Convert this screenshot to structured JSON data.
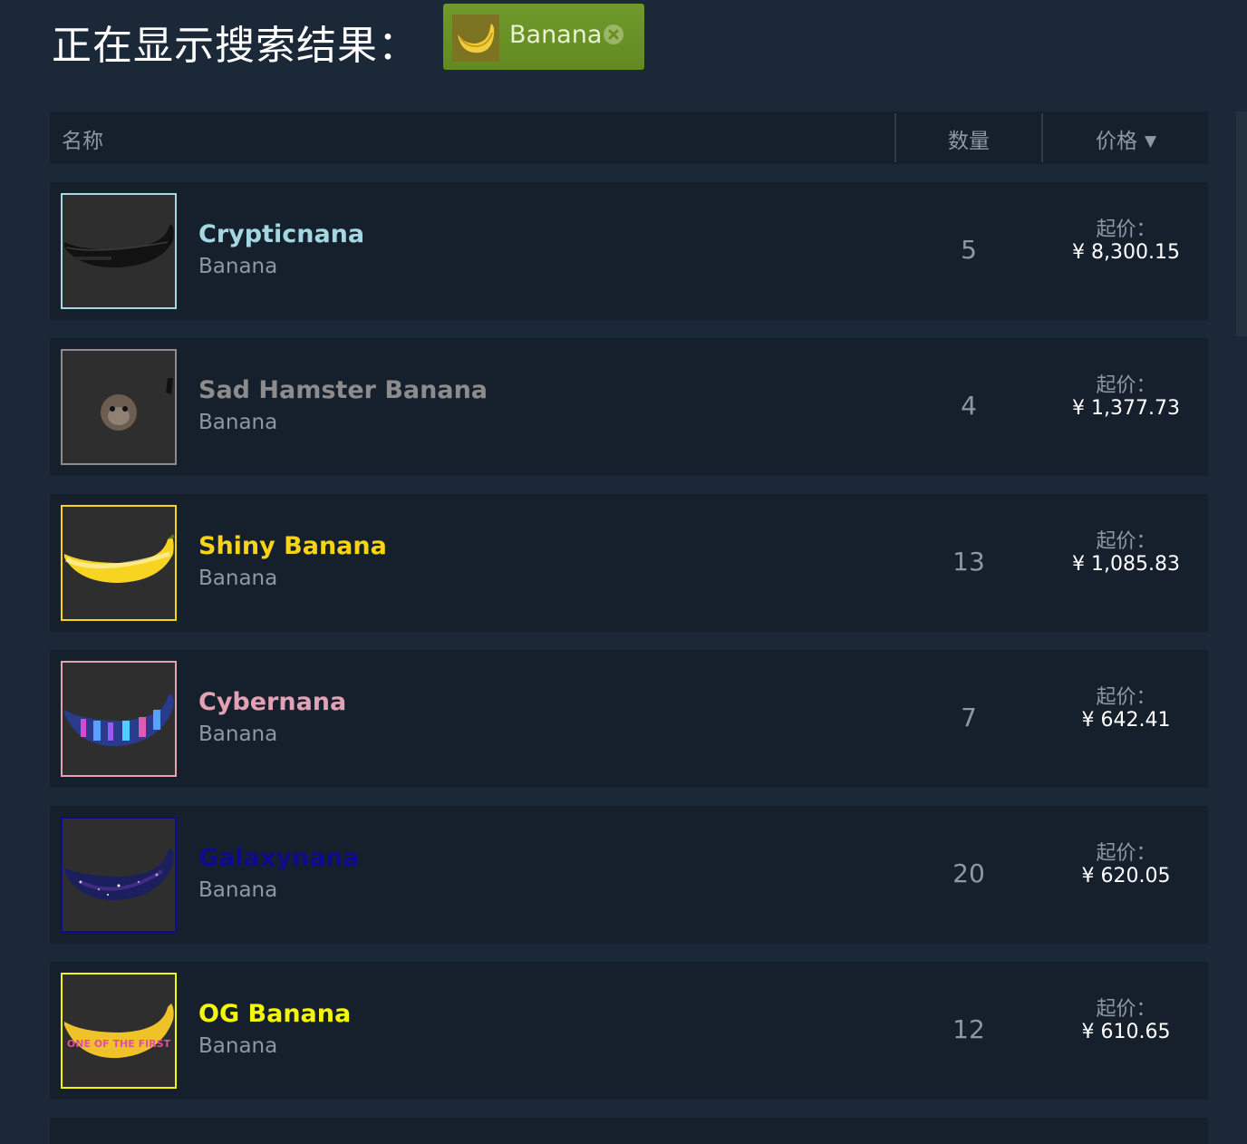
{
  "search": {
    "title": "正在显示搜索结果：",
    "filter_tag": {
      "label": "Banana",
      "remove_icon": "close-circle-icon"
    }
  },
  "table": {
    "columns": {
      "name": "名称",
      "quantity": "数量",
      "price": "价格",
      "sort_indicator": "▼"
    }
  },
  "listings": [
    {
      "name": "Crypticnana",
      "game": "Banana",
      "quantity": "5",
      "price_label": "起价：",
      "price": "¥ 8,300.15",
      "name_color": "#a3d8e3",
      "border_color": "#a3d8e3",
      "thumb": "crypticnana-banana"
    },
    {
      "name": "Sad Hamster Banana",
      "game": "Banana",
      "quantity": "4",
      "price_label": "起价：",
      "price": "¥ 1,377.73",
      "name_color": "#8c8c8c",
      "border_color": "#8c8c8c",
      "thumb": "sad-hamster-banana"
    },
    {
      "name": "Shiny Banana",
      "game": "Banana",
      "quantity": "13",
      "price_label": "起价：",
      "price": "¥ 1,085.83",
      "name_color": "#f7d417",
      "border_color": "#f7d417",
      "thumb": "shiny-banana"
    },
    {
      "name": "Cybernana",
      "game": "Banana",
      "quantity": "7",
      "price_label": "起价：",
      "price": "¥ 642.41",
      "name_color": "#e3a1b4",
      "border_color": "#e3a1b4",
      "thumb": "cybernana-banana"
    },
    {
      "name": "Galaxynana",
      "game": "Banana",
      "quantity": "20",
      "price_label": "起价：",
      "price": "¥ 620.05",
      "name_color": "#0c0c8c",
      "border_color": "#0c0c8c",
      "thumb": "galaxynana-banana"
    },
    {
      "name": "OG Banana",
      "game": "Banana",
      "quantity": "12",
      "price_label": "起价：",
      "price": "¥ 610.65",
      "name_color": "#f5f50a",
      "border_color": "#f5f50a",
      "thumb": "og-banana",
      "thumb_text": "ONE OF THE FIRST"
    }
  ]
}
